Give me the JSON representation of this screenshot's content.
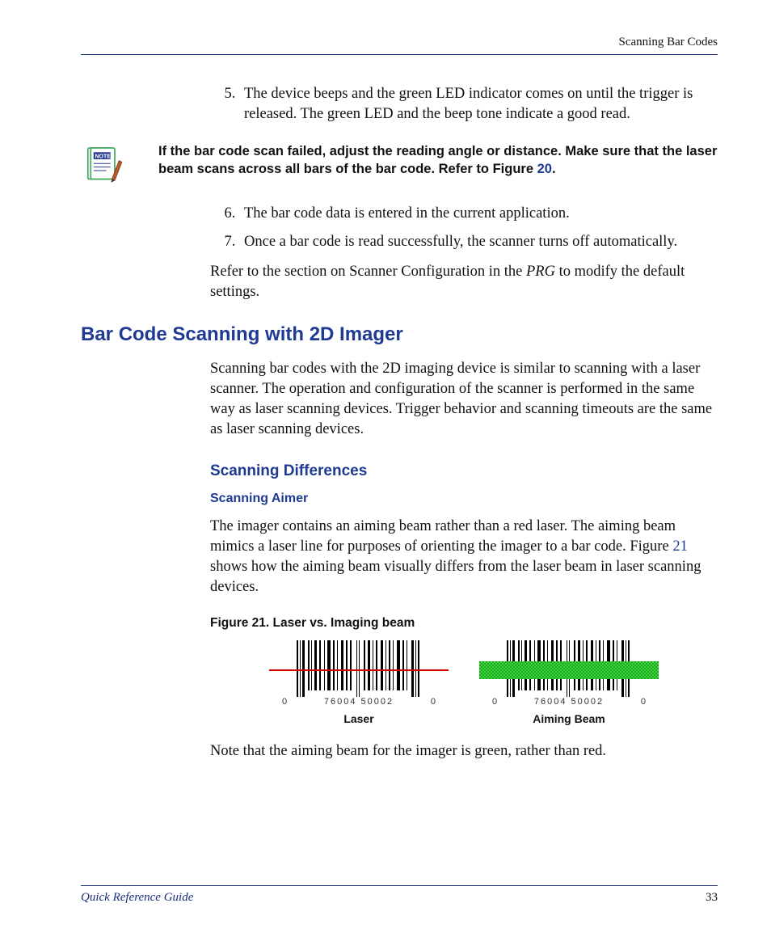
{
  "header": {
    "right": "Scanning Bar Codes"
  },
  "steps1": {
    "start": 5,
    "items": [
      "The device beeps and the green LED indicator comes on until the trigger is released. The green LED and the beep tone indicate a good read."
    ]
  },
  "note": {
    "prefix": "If the bar code scan failed, adjust the reading angle or distance. Make sure that the laser beam scans across all bars of the bar code. Refer to Figure ",
    "figref": "20",
    "suffix": "."
  },
  "steps2": {
    "start": 6,
    "items": [
      "The bar code data is entered in the current application.",
      "Once a bar code is read successfully, the scanner turns off automatically."
    ]
  },
  "refer_para": {
    "before_italic": "Refer to the section on Scanner Configuration in the ",
    "italic": "PRG",
    "after_italic": " to modify the default settings."
  },
  "h2": "Bar Code Scanning with 2D Imager",
  "h2_para": "Scanning bar codes with the 2D imaging device is similar to scanning with a laser scanner. The operation and configuration of the scanner is performed in the same way as laser scanning devices. Trigger behavior and scanning timeouts are the same as laser scanning devices.",
  "h3": "Scanning Differences",
  "h4": "Scanning Aimer",
  "aimer_para": {
    "before_ref": "The imager contains an aiming beam rather than a red laser. The aiming beam mimics a laser line for purposes of orienting the imager to a bar code. Figure ",
    "ref": "21",
    "after_ref": " shows how the aiming beam visually differs from the laser beam in laser scanning devices."
  },
  "fig_caption": "Figure 21. Laser vs. Imaging beam",
  "fig": {
    "barcode_left_digit": "0",
    "barcode_mid": "76004  50002",
    "barcode_right_digit": "0",
    "label_laser": "Laser",
    "label_aim": "Aiming Beam"
  },
  "closing_para": "Note that the aiming beam for the imager is green, rather than red.",
  "footer": {
    "left": "Quick Reference Guide",
    "page": "33"
  }
}
